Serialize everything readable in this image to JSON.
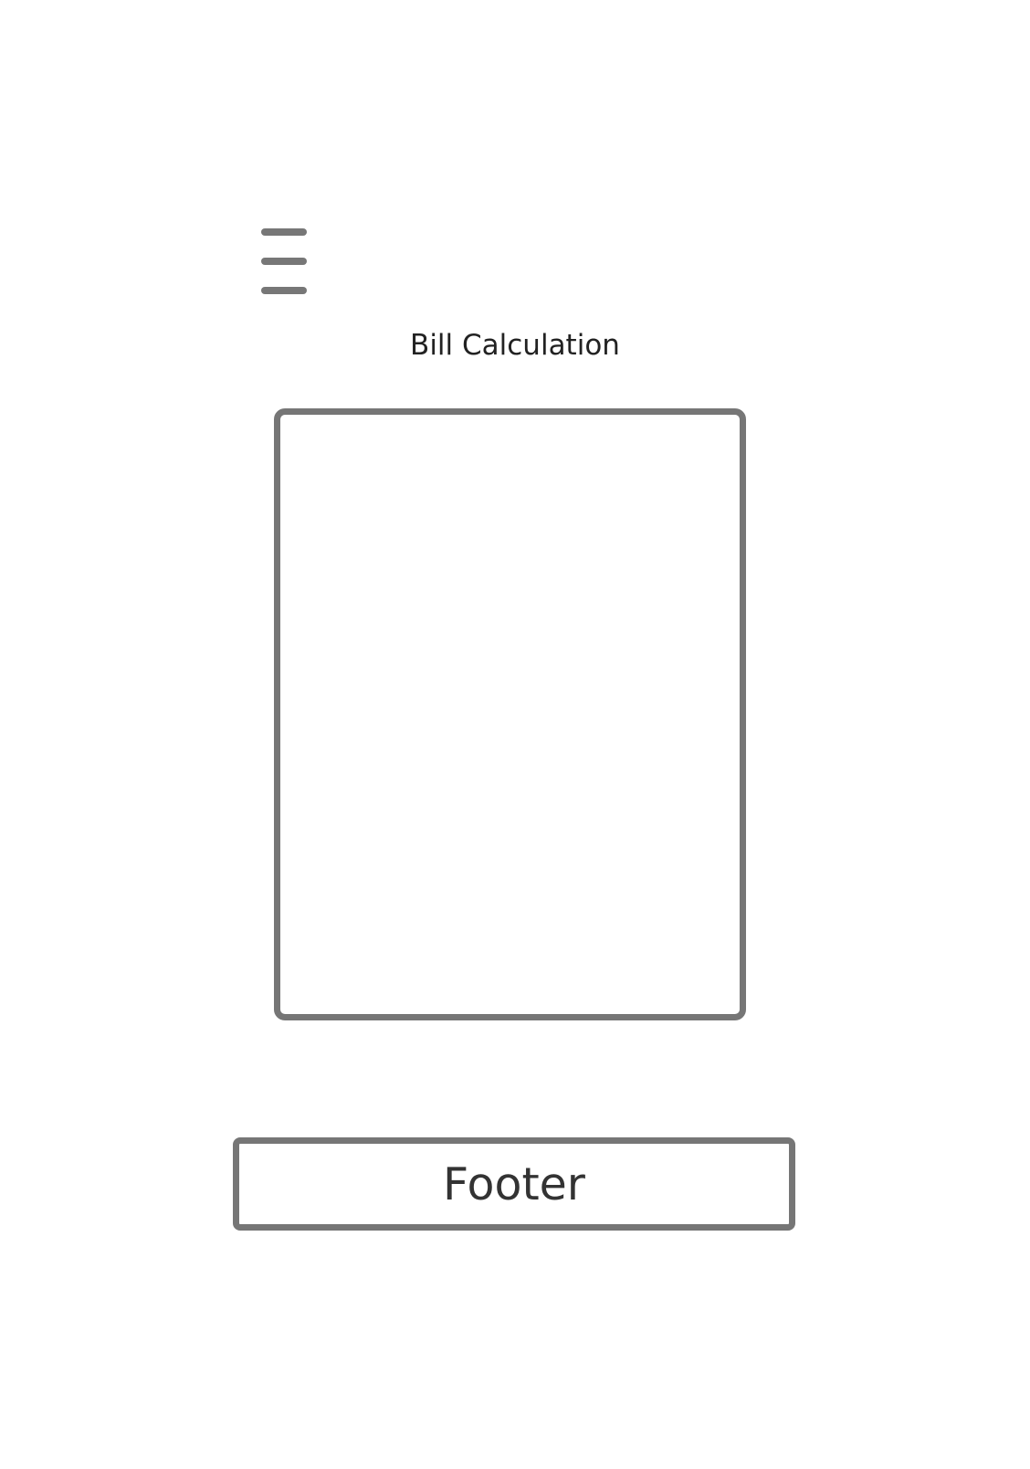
{
  "header": {
    "menu_icon": "hamburger-menu-icon",
    "title": "Bill Calculation"
  },
  "main": {
    "content_card": {}
  },
  "footer": {
    "label": "Footer"
  },
  "colors": {
    "outline": "#767676",
    "text": "#222222",
    "background": "#ffffff"
  }
}
